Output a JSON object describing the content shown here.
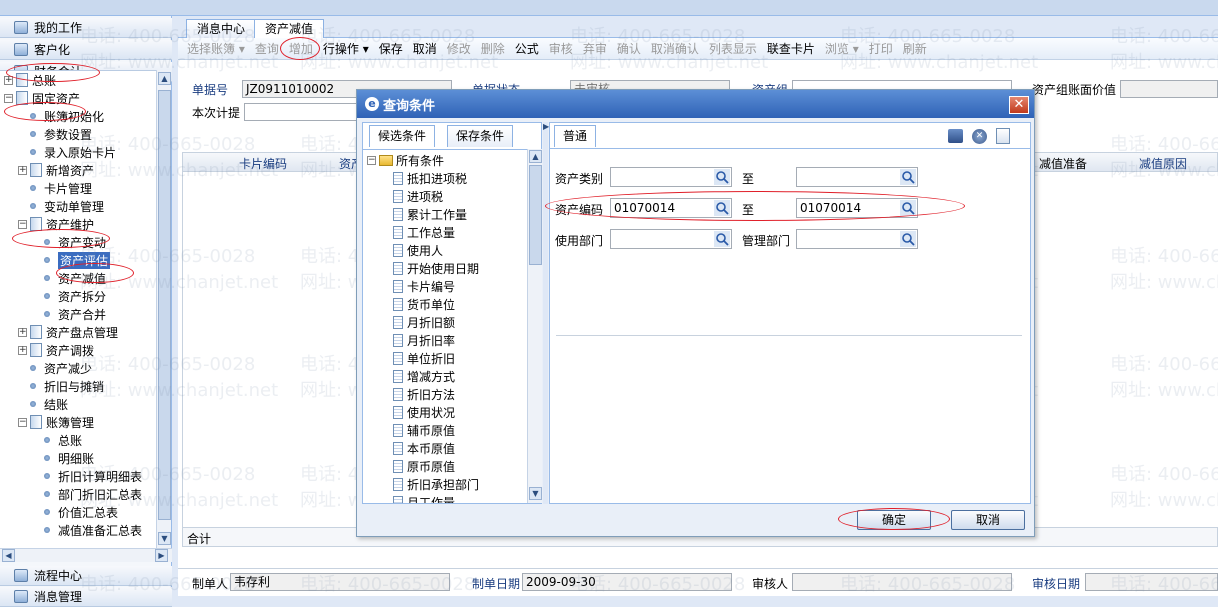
{
  "nav": {
    "my_work": "我的工作",
    "customize": "客户化",
    "finance": "财务会计",
    "process_center": "流程中心",
    "message_mgmt": "消息管理"
  },
  "tree": [
    {
      "label": "总账",
      "kind": "book",
      "pm": "+",
      "indent": 0
    },
    {
      "label": "固定资产",
      "kind": "book",
      "pm": "-",
      "indent": 0
    },
    {
      "label": "账簿初始化",
      "kind": "dot",
      "indent": 1
    },
    {
      "label": "参数设置",
      "kind": "dot",
      "indent": 1
    },
    {
      "label": "录入原始卡片",
      "kind": "dot",
      "indent": 1
    },
    {
      "label": "新增资产",
      "kind": "book",
      "pm": "+",
      "indent": 1
    },
    {
      "label": "卡片管理",
      "kind": "dot",
      "indent": 1
    },
    {
      "label": "变动单管理",
      "kind": "dot",
      "indent": 1
    },
    {
      "label": "资产维护",
      "kind": "book",
      "pm": "-",
      "indent": 1
    },
    {
      "label": "资产变动",
      "kind": "dot",
      "indent": 2
    },
    {
      "label": "资产评估",
      "kind": "dot",
      "indent": 2,
      "selected": true
    },
    {
      "label": "资产减值",
      "kind": "dot",
      "indent": 2
    },
    {
      "label": "资产拆分",
      "kind": "dot",
      "indent": 2
    },
    {
      "label": "资产合并",
      "kind": "dot",
      "indent": 2
    },
    {
      "label": "资产盘点管理",
      "kind": "book",
      "pm": "+",
      "indent": 1
    },
    {
      "label": "资产调拨",
      "kind": "book",
      "pm": "+",
      "indent": 1
    },
    {
      "label": "资产减少",
      "kind": "dot",
      "indent": 1
    },
    {
      "label": "折旧与摊销",
      "kind": "dot",
      "indent": 1
    },
    {
      "label": "结账",
      "kind": "dot",
      "indent": 1
    },
    {
      "label": "账簿管理",
      "kind": "book",
      "pm": "-",
      "indent": 1
    },
    {
      "label": "总账",
      "kind": "dot",
      "indent": 2
    },
    {
      "label": "明细账",
      "kind": "dot",
      "indent": 2
    },
    {
      "label": "折旧计算明细表",
      "kind": "dot",
      "indent": 2
    },
    {
      "label": "部门折旧汇总表",
      "kind": "dot",
      "indent": 2
    },
    {
      "label": "价值汇总表",
      "kind": "dot",
      "indent": 2
    },
    {
      "label": "减值准备汇总表",
      "kind": "dot",
      "indent": 2
    }
  ],
  "tabs": [
    "消息中心",
    "资产减值"
  ],
  "toolbar": [
    {
      "label": "选择账簿 ▾",
      "enabled": false
    },
    {
      "label": "查询",
      "enabled": false
    },
    {
      "label": "增加",
      "enabled": false
    },
    {
      "label": "行操作 ▾",
      "enabled": true
    },
    {
      "label": "保存",
      "enabled": true
    },
    {
      "label": "取消",
      "enabled": true
    },
    {
      "label": "修改",
      "enabled": false
    },
    {
      "label": "删除",
      "enabled": false
    },
    {
      "label": "公式",
      "enabled": true
    },
    {
      "label": "审核",
      "enabled": false
    },
    {
      "label": "弃审",
      "enabled": false
    },
    {
      "label": "确认",
      "enabled": false
    },
    {
      "label": "取消确认",
      "enabled": false
    },
    {
      "label": "列表显示",
      "enabled": false
    },
    {
      "label": "联查卡片",
      "enabled": true
    },
    {
      "label": "浏览 ▾",
      "enabled": false
    },
    {
      "label": "打印",
      "enabled": false
    },
    {
      "label": "刷新",
      "enabled": false
    }
  ],
  "form": {
    "doc_no_label": "单据号",
    "doc_no_value": "JZ0911010002",
    "status_label": "单据状态",
    "status_value": "未审核",
    "asset_group_label": "资产组",
    "asset_group_book_value_label": "资产组账面价值",
    "current_provision_label": "本次计提"
  },
  "grid": {
    "headers": [
      "卡片编码",
      "资产",
      "减值准备",
      "减值原因"
    ],
    "total_label": "合计"
  },
  "footer": {
    "maker_label": "制单人",
    "maker_value": "韦存利",
    "make_date_label": "制单日期",
    "make_date_value": "2009-09-30",
    "auditor_label": "审核人",
    "audit_date_label": "审核日期"
  },
  "dialog": {
    "title": "查询条件",
    "close": "✕",
    "tab_candidates": "候选条件",
    "tab_saved": "保存条件",
    "tab_normal": "普通",
    "tree_root": "所有条件",
    "conditions": [
      "抵扣进项税",
      "进项税",
      "累计工作量",
      "工作总量",
      "使用人",
      "开始使用日期",
      "卡片编号",
      "货币单位",
      "月折旧额",
      "月折旧率",
      "单位折旧",
      "增减方式",
      "折旧方法",
      "使用状况",
      "辅币原值",
      "本币原值",
      "原币原值",
      "折旧承担部门",
      "月工作量"
    ],
    "asset_category_label": "资产类别",
    "to_label": "至",
    "asset_code_label": "资产编码",
    "asset_code_from": "01070014",
    "asset_code_to": "01070014",
    "use_dept_label": "使用部门",
    "mgmt_dept_label": "管理部门",
    "ok": "确定",
    "cancel": "取消"
  },
  "watermark": {
    "phone": "电话: 400-665-0028",
    "site": "网址: www.chanjet.net"
  },
  "colors": {
    "accent": "#2f62b6",
    "annotation": "#e0202a",
    "selected": "#3a6cc0"
  }
}
